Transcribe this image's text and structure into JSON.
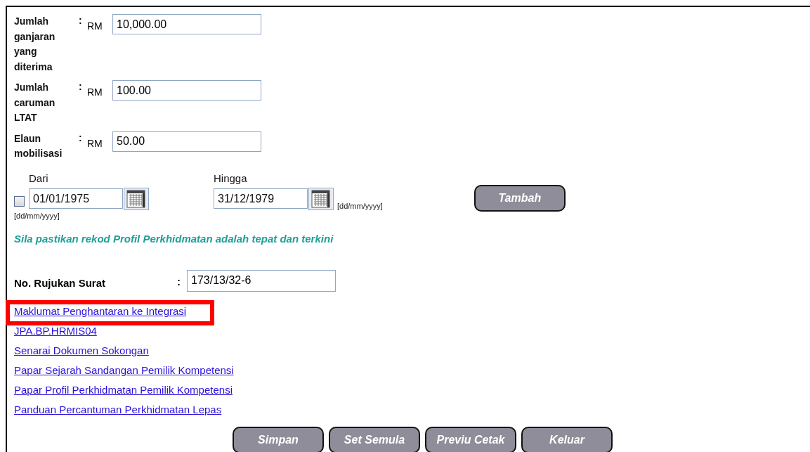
{
  "amount_fields": [
    {
      "label": "Jumlah ganjaran yang diterima",
      "separator": ":",
      "currency": "RM",
      "value": "10,000.00"
    },
    {
      "label": "Jumlah caruman LTAT",
      "separator": ":",
      "currency": "RM",
      "value": "100.00"
    },
    {
      "label": "Elaun mobilisasi",
      "separator": ":",
      "currency": "RM",
      "value": "50.00"
    }
  ],
  "period": {
    "checked": false,
    "from": {
      "label": "Dari",
      "value": "01/01/1975",
      "format_hint": "[dd/mm/yyyy]"
    },
    "to": {
      "label": "Hingga",
      "value": "31/12/1979",
      "format_hint": "[dd/mm/yyyy]"
    },
    "add_button": "Tambah"
  },
  "notice": "Sila pastikan rekod Profil Perkhidmatan adalah tepat dan terkini",
  "reference": {
    "label": "No. Rujukan Surat",
    "separator": ":",
    "value": "173/13/32-6"
  },
  "links": [
    {
      "text": "Maklumat Penghantaran ke Integrasi",
      "highlighted": true
    },
    {
      "text": "JPA.BP.HRMIS04",
      "highlighted": false
    },
    {
      "text": "Senarai Dokumen Sokongan",
      "highlighted": false
    },
    {
      "text": "Papar Sejarah Sandangan Pemilik Kompetensi",
      "highlighted": false
    },
    {
      "text": "Papar Profil Perkhidmatan Pemilik Kompetensi",
      "highlighted": false
    },
    {
      "text": "Panduan Percantuman Perkhidmatan Lepas",
      "highlighted": false
    }
  ],
  "buttons": [
    "Simpan",
    "Set Semula",
    "Previu Cetak",
    "Keluar"
  ]
}
